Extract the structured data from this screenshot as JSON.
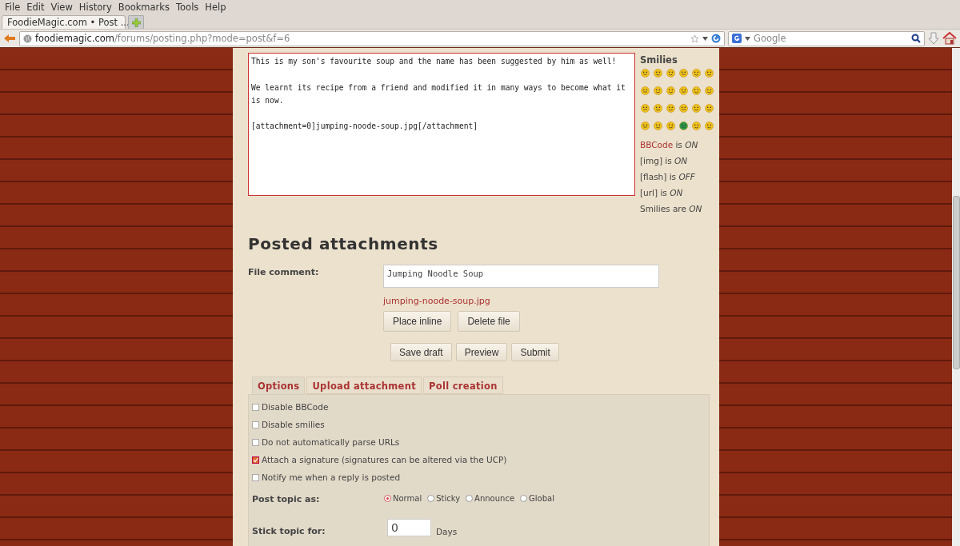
{
  "browser": {
    "menu": [
      "File",
      "Edit",
      "View",
      "History",
      "Bookmarks",
      "Tools",
      "Help"
    ],
    "tabs": [
      {
        "title": "FoodieMagic.com • Post ...",
        "selected": true
      }
    ],
    "url": {
      "host": "foodiemagic.com",
      "path": "/forums/posting.php?mode=post&f=6"
    },
    "search": {
      "placeholder": "Google"
    }
  },
  "editor": {
    "message": "This is my son's favourite soup and the name has been suggested by him as well!\n\nWe learnt its recipe from a friend and modified it in many ways to become what it is now.\n\n[attachment=0]jumping-noode-soup.jpg[/attachment]",
    "smilies_title": "Smilies",
    "status": [
      {
        "link": "BBCode",
        "text": " is *ON*"
      },
      {
        "text": "[img] is *ON*"
      },
      {
        "text": "[flash] is *OFF*"
      },
      {
        "text": "[url] is *ON*"
      },
      {
        "text": "Smilies are *ON*"
      }
    ]
  },
  "attachments": {
    "title": "Posted attachments",
    "comment_label": "File comment:",
    "comment_value": "Jumping Noodle Soup",
    "file_link": "jumping-noode-soup.jpg",
    "file_buttons": [
      "Place inline",
      "Delete file"
    ]
  },
  "actions": [
    "Save draft",
    "Preview",
    "Submit"
  ],
  "options": {
    "tabs": [
      {
        "label": "Options",
        "selected": true
      },
      {
        "label": "Upload attachment",
        "selected": false
      },
      {
        "label": "Poll creation",
        "selected": false
      }
    ],
    "checkboxes": [
      {
        "label": "Disable BBCode",
        "checked": false
      },
      {
        "label": "Disable smilies",
        "checked": false
      },
      {
        "label": "Do not automatically parse URLs",
        "checked": false
      },
      {
        "label": "Attach a signature (signatures can be altered via the UCP)",
        "checked": true
      },
      {
        "label": "Notify me when a reply is posted",
        "checked": false
      }
    ],
    "post_as_label": "Post topic as:",
    "post_as": [
      {
        "label": "Normal",
        "selected": true
      },
      {
        "label": "Sticky",
        "selected": false
      },
      {
        "label": "Announce",
        "selected": false
      },
      {
        "label": "Global",
        "selected": false
      }
    ],
    "stick_label": "Stick topic for:",
    "stick_value": "0",
    "stick_unit": "Days"
  }
}
